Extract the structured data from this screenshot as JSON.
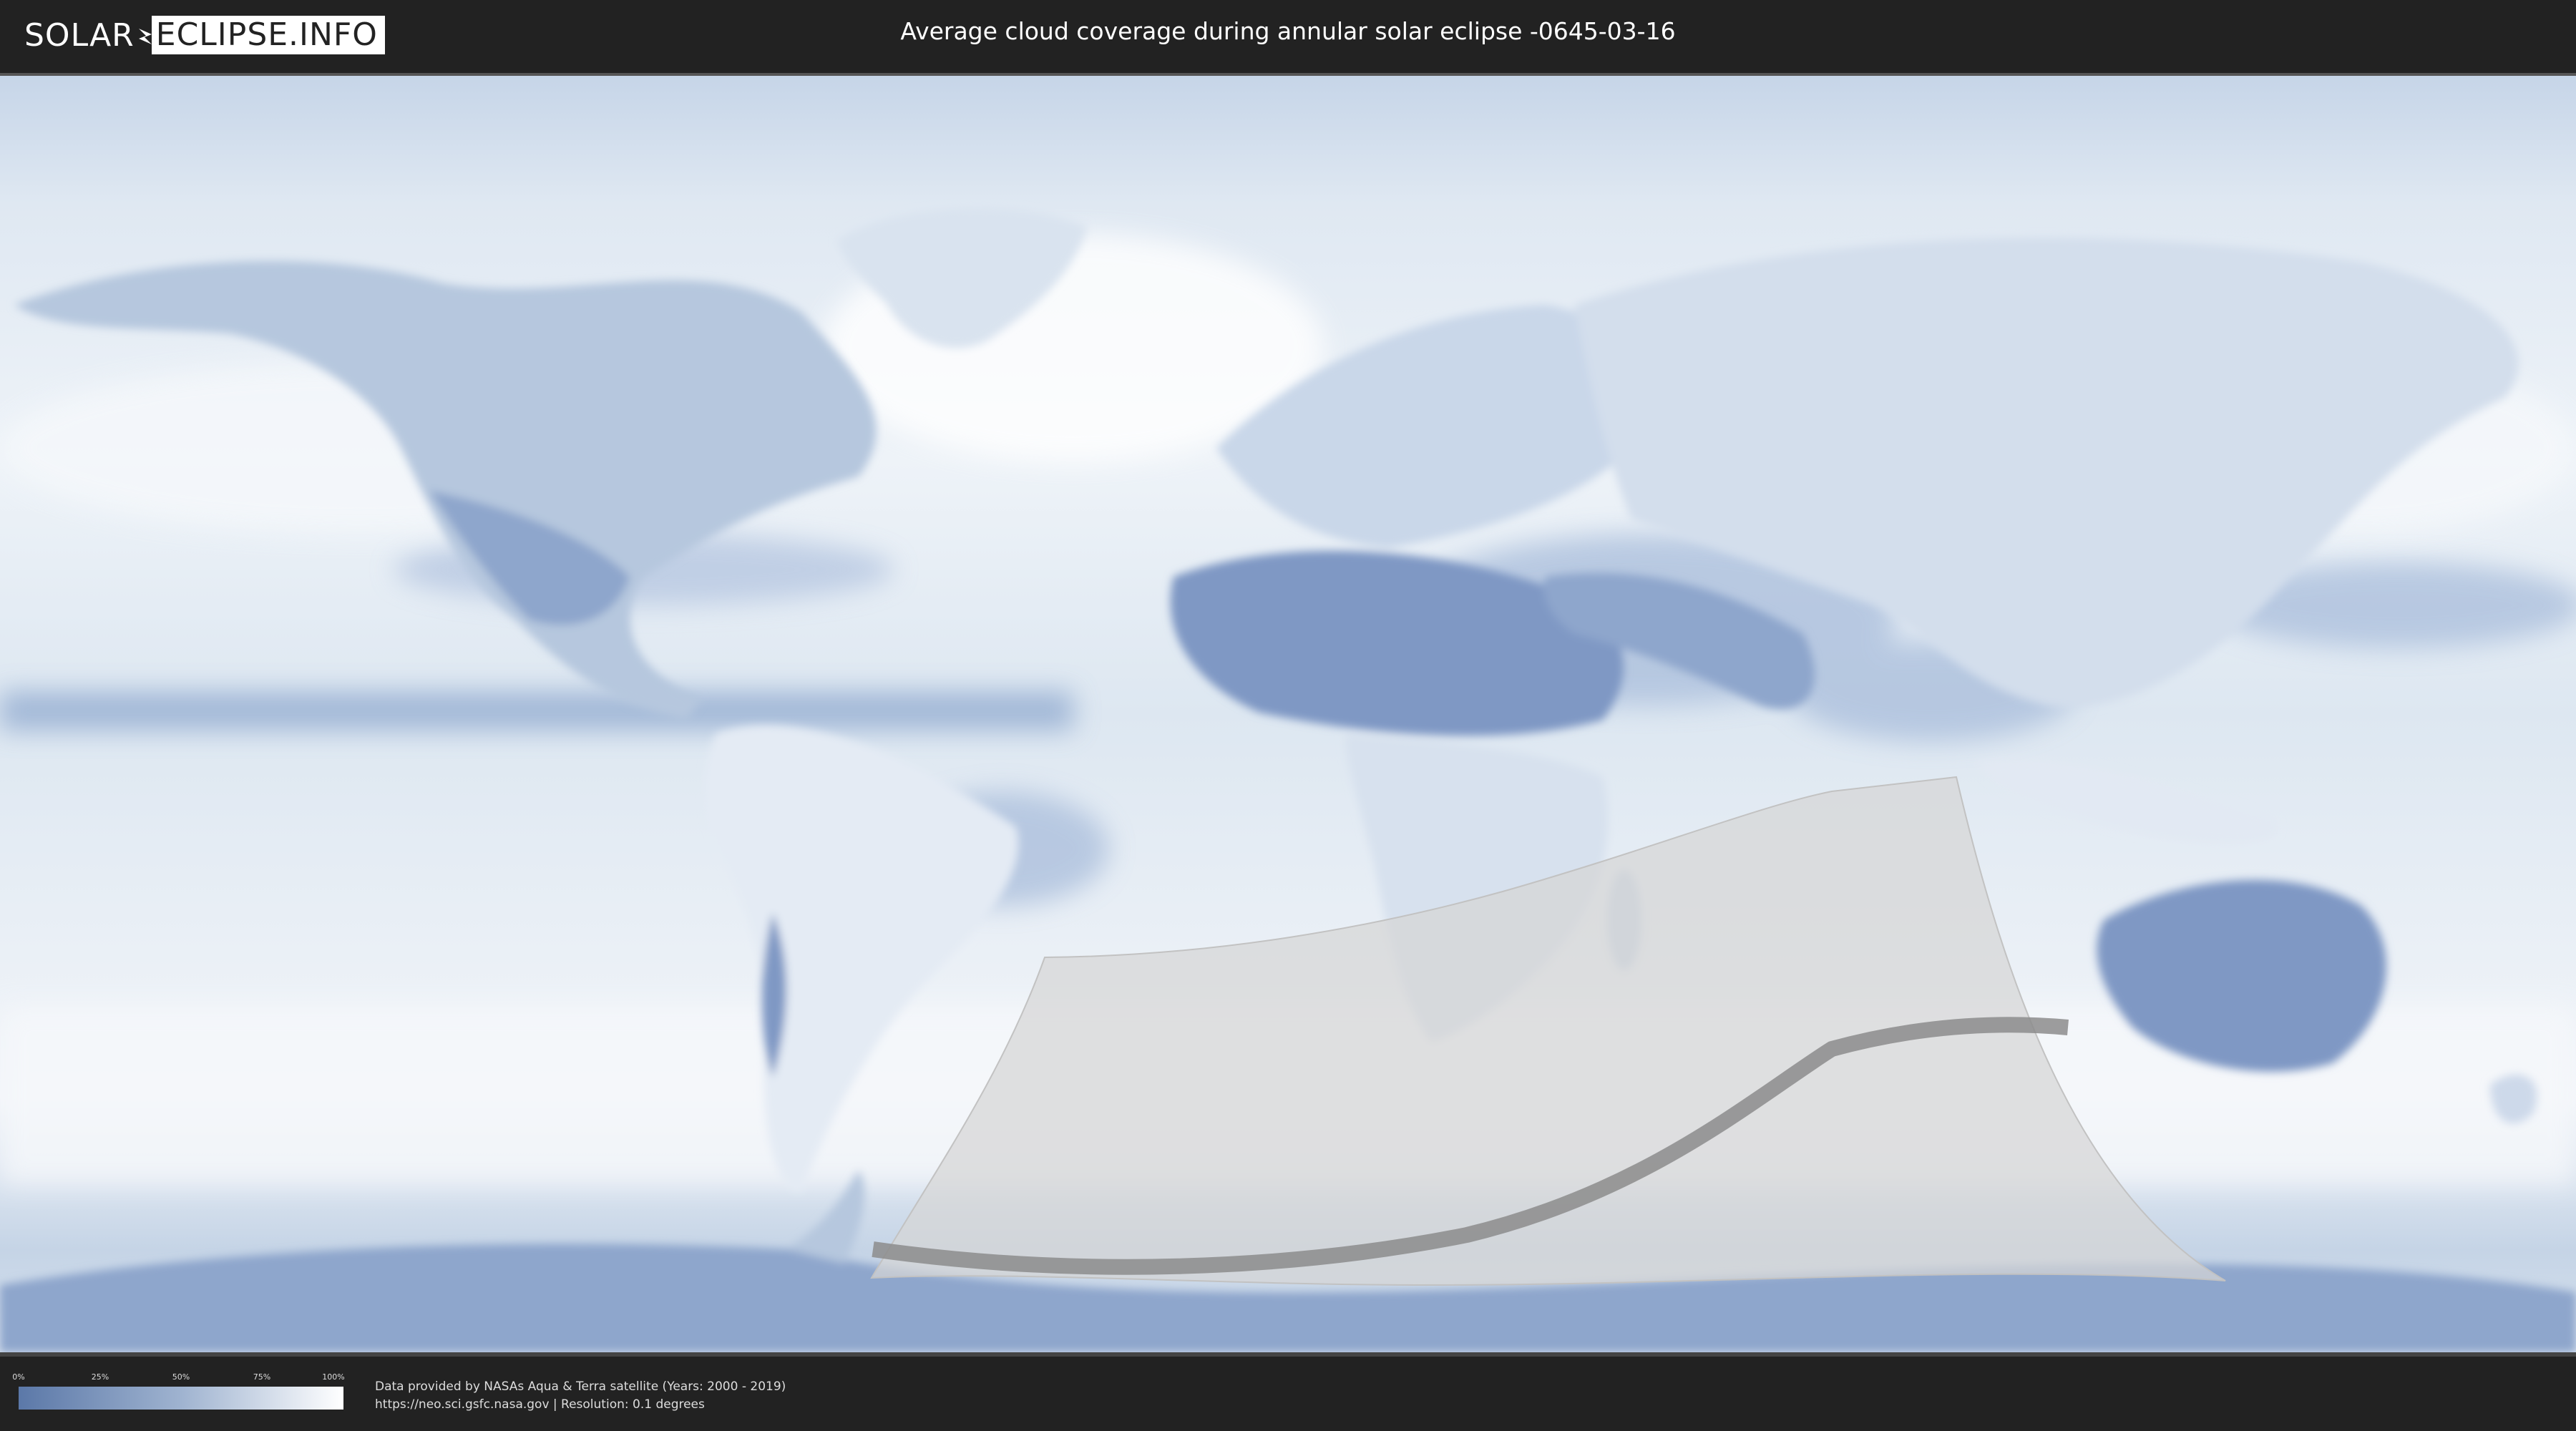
{
  "header": {
    "logo_part1": "SOLAR",
    "logo_part2": "ECLIPSE.INFO",
    "title": "Average cloud coverage during annular solar eclipse -0645-03-16"
  },
  "legend": {
    "ticks": [
      "0%",
      "25%",
      "50%",
      "75%",
      "100%"
    ],
    "gradient_colors": [
      "#5b78a8",
      "#9fb3d0",
      "#ffffff"
    ]
  },
  "footer": {
    "credit_line1": "Data provided by NASAs Aqua & Terra satellite (Years: 2000 - 2019)",
    "credit_line2": "https://neo.sci.gsfc.nasa.gov | Resolution: 0.1 degrees"
  },
  "colors": {
    "background": "#222222",
    "ocean_cloud": "#b9cce3",
    "land_low_cloud": "#7f98c4",
    "high_cloud": "#f3f6fa",
    "eclipse_zone": "#d5d5d5",
    "central_path": "#8c8c8c"
  }
}
